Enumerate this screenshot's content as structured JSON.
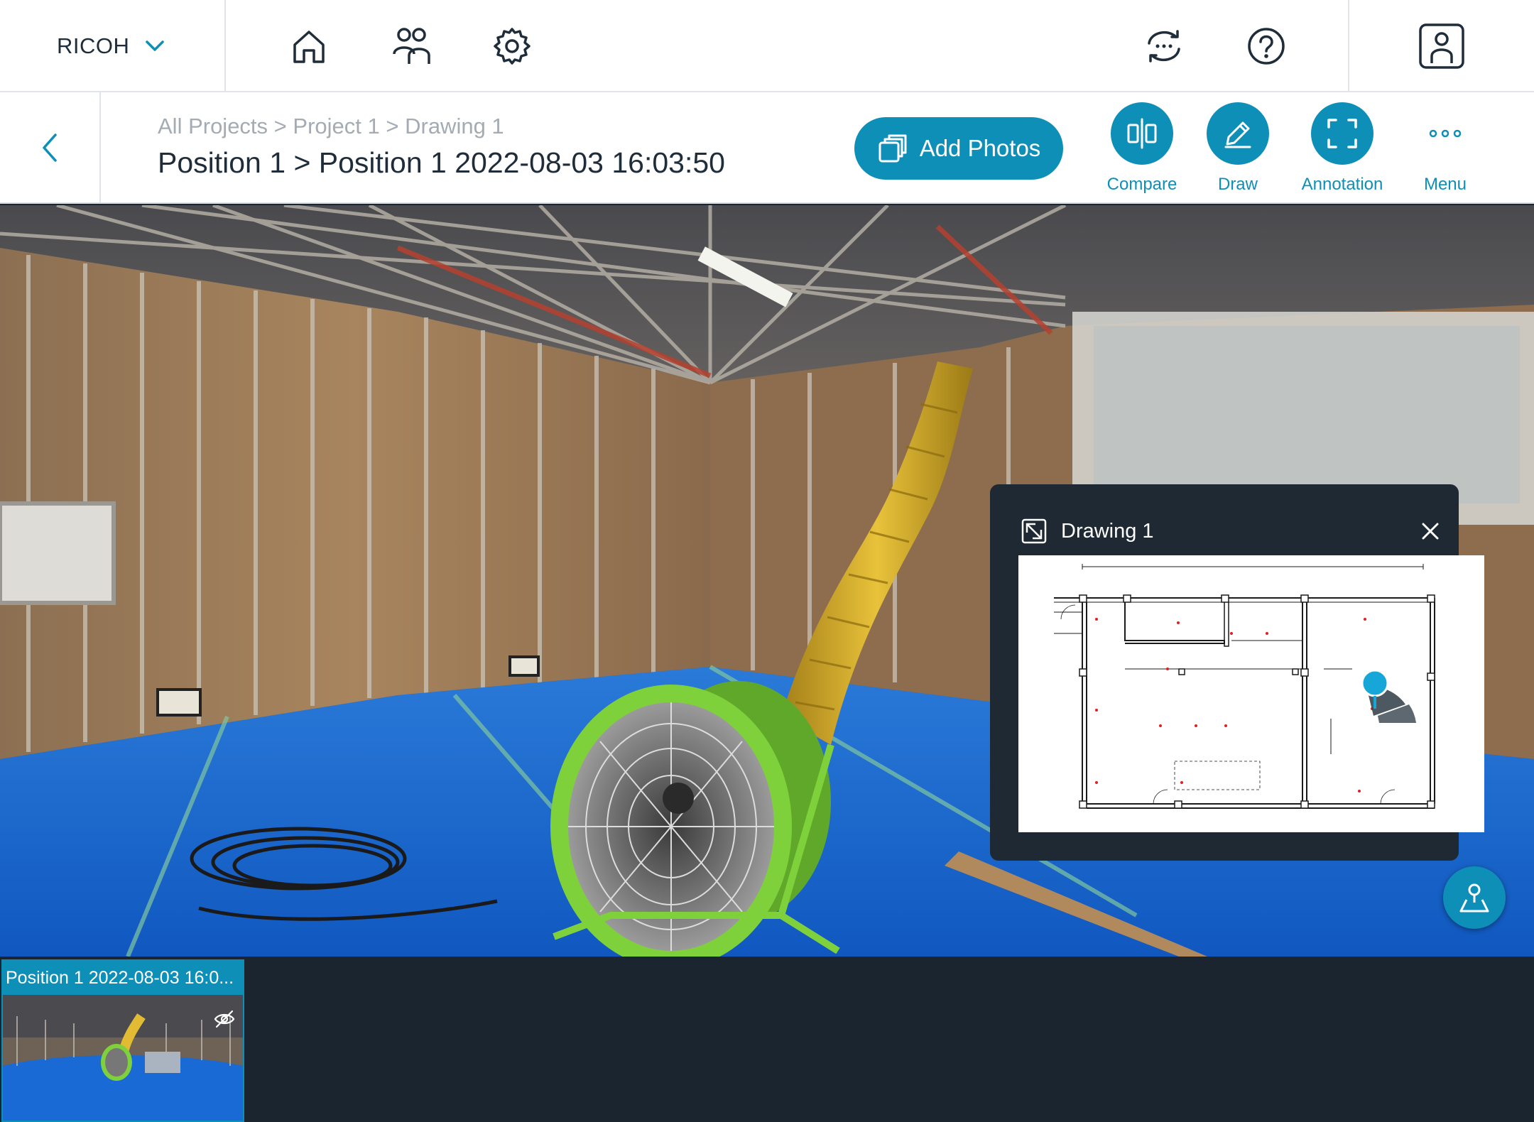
{
  "app": {
    "brand": "RICOH",
    "nav_icons": [
      "home-icon",
      "users-icon",
      "settings-icon"
    ],
    "right_icons": [
      "sync-icon",
      "help-icon",
      "account-icon"
    ]
  },
  "header": {
    "breadcrumb": [
      "All Projects",
      "Project 1",
      "Drawing 1"
    ],
    "breadcrumb_separator": ">",
    "title": "Position 1 > Position 1 2022-08-03 16:03:50",
    "add_photos_label": "Add Photos",
    "tools": [
      {
        "label": "Compare",
        "icon": "compare-icon"
      },
      {
        "label": "Draw",
        "icon": "pencil-icon"
      },
      {
        "label": "Annotation",
        "icon": "annotation-icon"
      },
      {
        "label": "Menu",
        "icon": "more-icon"
      }
    ]
  },
  "drawing_panel": {
    "title": "Drawing 1",
    "icon": "expand-icon",
    "close_icon": "close-icon"
  },
  "filmstrip": {
    "items": [
      {
        "label": "Position 1 2022-08-03 16:0...",
        "badge_icon": "hidden-icon"
      }
    ]
  },
  "colors": {
    "accent": "#0e8fb8",
    "dark_bg": "#1b2530",
    "floor_blue": "#1565c8",
    "fan_green": "#7fd13b",
    "duct_yellow": "#d9b12a"
  }
}
